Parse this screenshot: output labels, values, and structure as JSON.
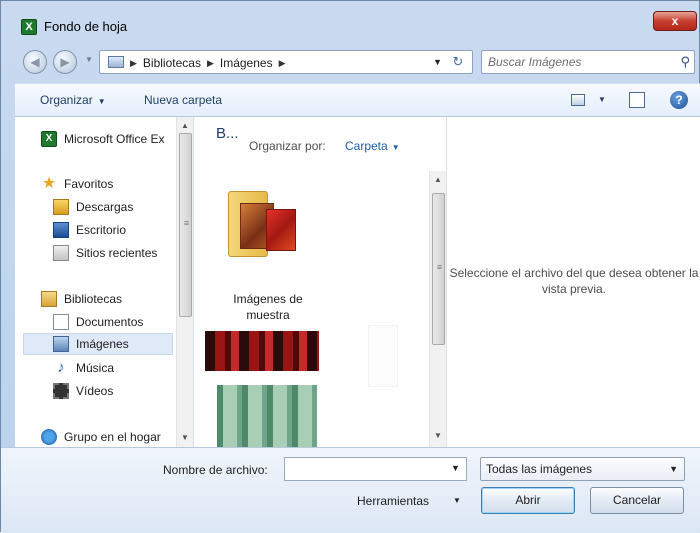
{
  "window": {
    "title": "Fondo de hoja",
    "close_label": "x"
  },
  "nav": {
    "back_glyph": "◀",
    "forward_glyph": "▶",
    "breadcrumbs": [
      "Bibliotecas",
      "Imágenes"
    ],
    "search_placeholder": "Buscar Imágenes"
  },
  "toolbar": {
    "organize_label": "Organizar",
    "new_folder_label": "Nueva carpeta",
    "help_label": "?"
  },
  "sidebar": {
    "items": [
      {
        "label": "Microsoft Office Ex",
        "icon": "excel-icon"
      },
      {
        "label": "Favoritos",
        "icon": "star-icon"
      },
      {
        "label": "Descargas",
        "icon": "downloads-icon"
      },
      {
        "label": "Escritorio",
        "icon": "desktop-icon"
      },
      {
        "label": "Sitios recientes",
        "icon": "recent-places-icon"
      },
      {
        "label": "Bibliotecas",
        "icon": "libraries-icon"
      },
      {
        "label": "Documentos",
        "icon": "documents-icon"
      },
      {
        "label": "Imágenes",
        "icon": "pictures-icon"
      },
      {
        "label": "Música",
        "icon": "music-icon"
      },
      {
        "label": "Vídeos",
        "icon": "videos-icon"
      },
      {
        "label": "Grupo en el hogar",
        "icon": "homegroup-icon"
      }
    ],
    "selected": "Imágenes"
  },
  "content": {
    "library_title": "B...",
    "arrange_label": "Organizar por:",
    "arrange_value": "Carpeta",
    "folder_label": "Imágenes de muestra"
  },
  "preview": {
    "message": "Seleccione el archivo del que desea obtener la vista previa."
  },
  "footer": {
    "filename_label": "Nombre de archivo:",
    "filename_value": "",
    "filetype_value": "Todas las imágenes",
    "tools_label": "Herramientas",
    "open_label": "Abrir",
    "cancel_label": "Cancelar"
  },
  "colors": {
    "accent": "#1e5ea8",
    "window_frame": "#bcd1ec",
    "close_button": "#c6402f"
  }
}
